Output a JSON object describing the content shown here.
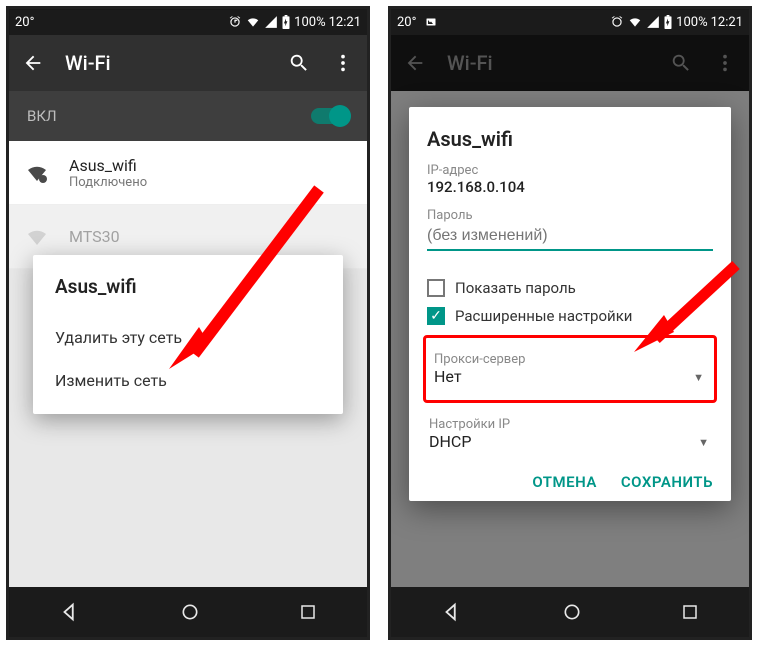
{
  "status": {
    "temp": "20°",
    "battery": "100%",
    "time": "12:21"
  },
  "appbar": {
    "title": "Wi-Fi"
  },
  "toggle": {
    "label": "ВКЛ"
  },
  "network": {
    "name": "Asus_wifi",
    "status": "Подключено",
    "other": "MTS30"
  },
  "context_menu": {
    "title": "Asus_wifi",
    "delete": "Удалить эту сеть",
    "modify": "Изменить сеть"
  },
  "edit_dialog": {
    "title": "Asus_wifi",
    "ip_label": "IP-адрес",
    "ip_value": "192.168.0.104",
    "password_label": "Пароль",
    "password_placeholder": "(без изменений)",
    "show_password": "Показать пароль",
    "advanced": "Расширенные настройки",
    "proxy_label": "Прокси-сервер",
    "proxy_value": "Нет",
    "ip_settings_label": "Настройки IP",
    "ip_settings_value": "DHCP",
    "cancel": "ОТМЕНА",
    "save": "СОХРАНИТЬ"
  }
}
